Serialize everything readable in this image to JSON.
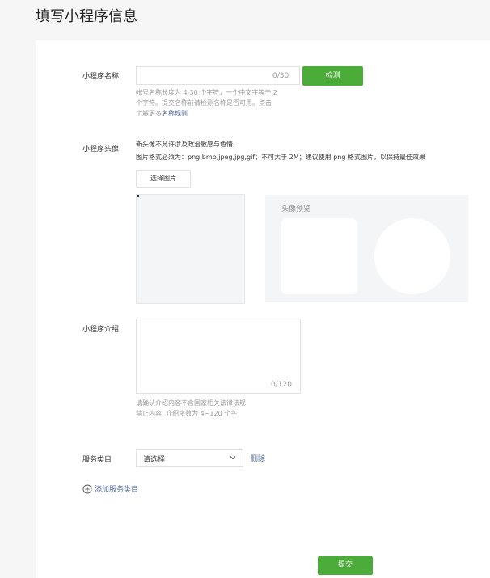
{
  "page": {
    "title": "填写小程序信息"
  },
  "name_section": {
    "label": "小程序名称",
    "input_value": "",
    "counter": "0/30",
    "check_button": "检测",
    "hint_line1": "帐号名称长度为 4-30 个字符，一个中文字等于 2",
    "hint_line2": "个字符。提交名称前请检测名称是否可用。点击",
    "hint_line3_prefix": "了解更多",
    "hint_link": "名称规则"
  },
  "avatar_section": {
    "label": "小程序头像",
    "desc_line1": "新头像不允许涉及政治敏感与色情;",
    "desc_line2": "图片格式必须为：png,bmp,jpeg,jpg,gif；不可大于 2M；建议使用 png 格式图片，以保持最佳效果",
    "select_button": "选择图片",
    "preview_title": "头像预览"
  },
  "intro_section": {
    "label": "小程序介绍",
    "textarea_value": "",
    "counter": "0/120",
    "hint_line1": "请确认介绍内容不含国家相关法律法规",
    "hint_line2": "禁止内容, 介绍字数为 4~120 个字"
  },
  "category_section": {
    "label": "服务类目",
    "select_value": "请选择",
    "delete_link": "删除",
    "add_link": "添加服务类目"
  },
  "footer": {
    "submit_button": "提交"
  },
  "colors": {
    "primary": "#4cac39",
    "link": "#576b95",
    "hint": "#9a9a9a",
    "background": "#f6f6f7"
  },
  "icons": {
    "add": "plus-circle-icon",
    "dropdown": "chevron-down-icon"
  }
}
